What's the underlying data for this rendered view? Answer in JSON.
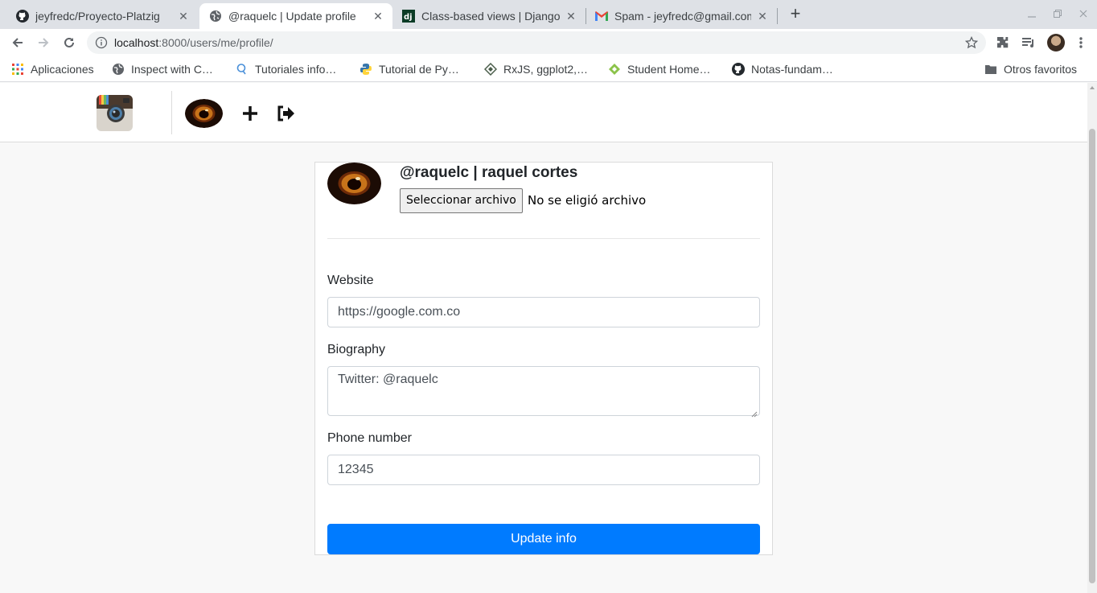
{
  "browser": {
    "tabs": [
      {
        "title": "jeyfredc/Proyecto-Platzig",
        "icon": "github-icon",
        "active": false
      },
      {
        "title": "@raquelc | Update profile",
        "icon": "globe-icon",
        "active": true
      },
      {
        "title": "Class-based views | Django",
        "icon": "django-icon",
        "active": false
      },
      {
        "title": "Spam - jeyfredc@gmail.com",
        "icon": "gmail-icon",
        "active": false
      }
    ],
    "close_glyph": "✕",
    "new_tab_glyph": "+",
    "url_host": "localhost",
    "url_path": ":8000/users/me/profile/",
    "bookmarks": [
      {
        "label": "Aplicaciones",
        "icon": "apps-grid-icon"
      },
      {
        "label": "Inspect with C…",
        "icon": "globe-icon"
      },
      {
        "label": "Tutoriales info…",
        "icon": "search-tutorial-icon"
      },
      {
        "label": "Tutorial de Py…",
        "icon": "python-icon"
      },
      {
        "label": "RxJS, ggplot2,…",
        "icon": "rxjs-icon"
      },
      {
        "label": "Student Home…",
        "icon": "student-icon"
      },
      {
        "label": "Notas-fundam…",
        "icon": "github-icon"
      }
    ],
    "other_bookmarks": "Otros favoritos"
  },
  "profile": {
    "heading": "@raquelc | raquel cortes",
    "file_button": "Seleccionar archivo",
    "file_status": "No se eligió archivo"
  },
  "form": {
    "website_label": "Website",
    "website_value": "https://google.com.co",
    "biography_label": "Biography",
    "biography_value": "Twitter: @raquelc",
    "phone_label": "Phone number",
    "phone_value": "12345",
    "submit_label": "Update info"
  },
  "colors": {
    "primary": "#007bff",
    "tabbar": "#dee1e6"
  }
}
